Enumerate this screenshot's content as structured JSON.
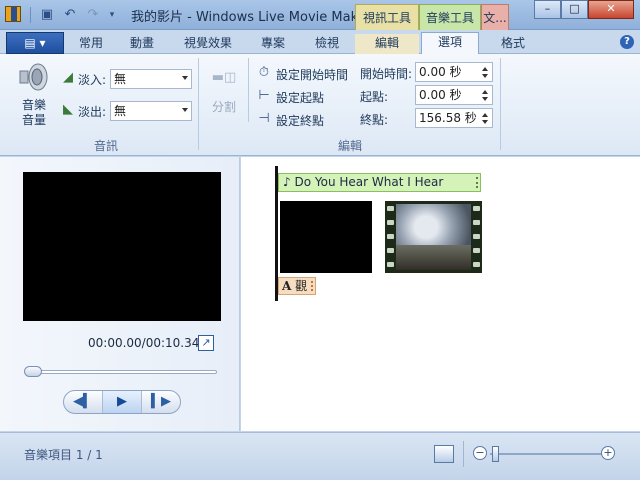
{
  "window": {
    "title": "我的影片 - Windows Live Movie Maker",
    "context_tabs": [
      "視訊工具",
      "音樂工具",
      "文..."
    ]
  },
  "qat": {
    "save_icon": "save-icon",
    "undo_icon": "undo-icon",
    "redo_icon": "redo-icon",
    "more_icon": "chevron-down-icon"
  },
  "ribbon_tabs": {
    "file": "▤ ▾",
    "items": [
      "常用",
      "動畫",
      "視覺效果",
      "專案",
      "檢視",
      "編輯",
      "選項",
      "格式"
    ],
    "active": "選項"
  },
  "audio_group": {
    "volume_label": "音樂音量",
    "fade_in_label": "淡入:",
    "fade_in_value": "無",
    "fade_out_label": "淡出:",
    "fade_out_value": "無",
    "group_label": "音訊"
  },
  "edit_group": {
    "split_label": "分割",
    "set_start_time": "設定開始時間",
    "set_start_point": "設定起點",
    "set_end_point": "設定終點",
    "start_time_label": "開始時間:",
    "start_time_value": "0.00 秒",
    "start_point_label": "起點:",
    "start_point_value": "0.00 秒",
    "end_point_label": "終點:",
    "end_point_value": "156.58 秒",
    "group_label": "編輯"
  },
  "preview": {
    "timecode": "00:00.00/00:10.34",
    "prev_frame_icon": "previous-frame-icon",
    "play_icon": "play-icon",
    "next_frame_icon": "next-frame-icon"
  },
  "storyboard": {
    "music_clip": "Do You Hear What I Hear",
    "title_clip": "觀"
  },
  "status": {
    "text": "音樂項目 1 / 1"
  }
}
